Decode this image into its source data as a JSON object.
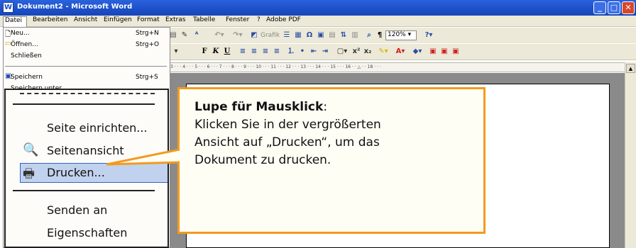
{
  "window": {
    "title": "Dokument2 - Microsoft Word",
    "app_icon": "W"
  },
  "menubar": {
    "items": [
      "Datei",
      "Bearbeiten",
      "Ansicht",
      "Einfügen",
      "Format",
      "Extras",
      "Tabelle",
      "Fenster",
      "?",
      "Adobe PDF"
    ]
  },
  "file_menu": {
    "items": [
      {
        "label": "Neu...",
        "shortcut": "Strg+N",
        "icon": "new-document-icon"
      },
      {
        "label": "Öffnen...",
        "shortcut": "Strg+O",
        "icon": "open-folder-icon"
      },
      {
        "label": "Schließen",
        "shortcut": "",
        "icon": ""
      },
      {
        "label": "Speichern",
        "shortcut": "Strg+S",
        "icon": "save-disk-icon"
      },
      {
        "label": "Speichern unter...",
        "shortcut": "",
        "icon": ""
      }
    ]
  },
  "magnifier": {
    "items": [
      {
        "label": "Seite einrichten...",
        "icon": ""
      },
      {
        "label": "Seitenansicht",
        "icon": "print-preview-icon"
      },
      {
        "label": "Drucken...",
        "icon": "printer-icon",
        "highlighted": true
      },
      {
        "label": "Senden an",
        "icon": ""
      },
      {
        "label": "Eigenschaften",
        "icon": ""
      }
    ]
  },
  "toolbar": {
    "zoom": "120%",
    "grafik_label": "Grafik",
    "font_style_buttons": [
      "F",
      "K",
      "U"
    ]
  },
  "ruler": {
    "labels": [
      "3",
      "4",
      "5",
      "6",
      "7",
      "8",
      "9",
      "10",
      "11",
      "12",
      "13",
      "14",
      "15",
      "16",
      "18"
    ]
  },
  "callout": {
    "title": "Lupe für Mausklick",
    "title_suffix": ":",
    "lines": [
      "Klicken Sie in der vergrößerten",
      "Ansicht auf „Drucken“, um das",
      "Dokument zu drucken."
    ]
  },
  "colors": {
    "accent": "#f39a1e",
    "titlebar": "#1c4fc7",
    "menu_bg": "#ece9d8",
    "highlight": "#c1d2ee"
  }
}
